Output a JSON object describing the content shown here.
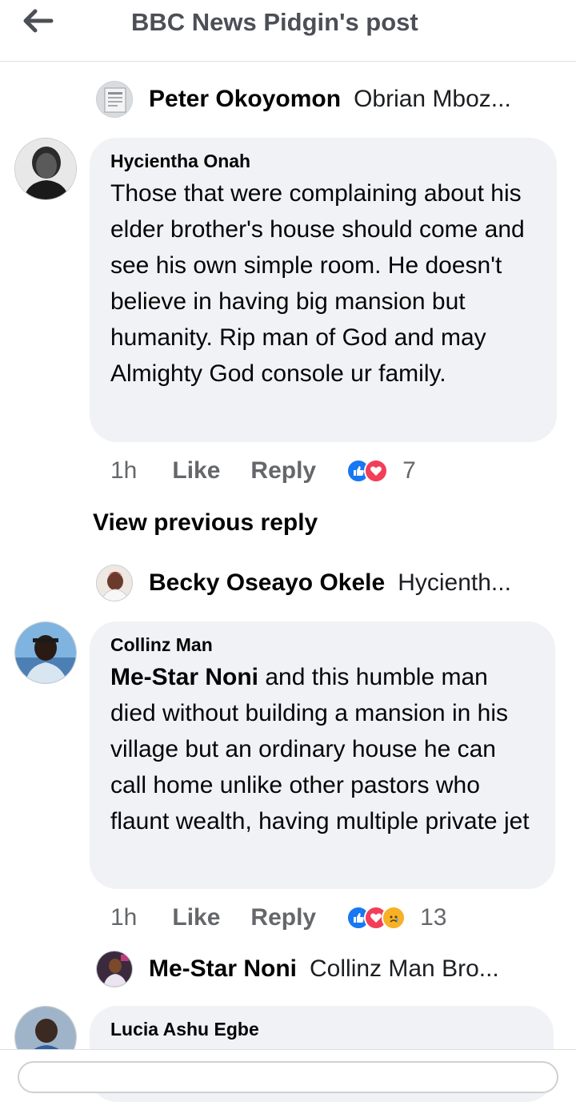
{
  "header": {
    "title": "BBC News Pidgin's post"
  },
  "threads": [
    {
      "reply_preview": {
        "name": "Peter Okoyomon",
        "text": "Obrian Mboz..."
      }
    },
    {
      "comment": {
        "author": "Hycientha Onah",
        "body": "Those that were complaining about his elder brother's house should come and see his own simple room. He doesn't believe in having big mansion but humanity. Rip man of God and may Almighty God console ur family.",
        "time": "1h",
        "like": "Like",
        "reply": "Reply",
        "reaction_count": "7"
      },
      "view_previous": "View previous reply",
      "reply_preview": {
        "name": "Becky Oseayo Okele",
        "text": "Hycienth..."
      }
    },
    {
      "comment": {
        "author": "Collinz Man",
        "mention": "Me-Star Noni",
        "body": " and this humble man died without building a mansion in his village but an ordinary house he can call home unlike other pastors who flaunt wealth, having multiple private jet",
        "time": "1h",
        "like": "Like",
        "reply": "Reply",
        "reaction_count": "13"
      },
      "reply_preview": {
        "name": "Me-Star Noni",
        "text": "Collinz Man Bro..."
      }
    },
    {
      "comment": {
        "author": "Lucia Ashu Egbe"
      }
    }
  ],
  "colors": {
    "like_blue": "#1877f2",
    "love_red": "#f33e58",
    "sad_yellow": "#f7b125",
    "meta_gray": "#65676b",
    "bubble_bg": "#f0f2f5"
  },
  "icons": {
    "back": "arrow-left-icon",
    "like": "thumbs-up-icon",
    "love": "heart-icon",
    "sad": "sad-face-icon"
  }
}
